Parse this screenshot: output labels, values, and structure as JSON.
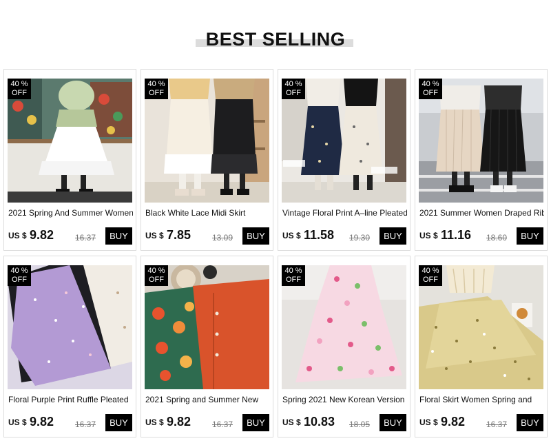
{
  "section": {
    "title": "BEST SELLING"
  },
  "products": [
    {
      "badge_pct": "40 %",
      "badge_off": "OFF",
      "title": "2021 Spring And Summer Women",
      "currency": "US $",
      "price": "9.82",
      "old_price": "16.37",
      "buy_label": "BUY"
    },
    {
      "badge_pct": "40 %",
      "badge_off": "OFF",
      "title": "Black White Lace Midi Skirt",
      "currency": "US $",
      "price": "7.85",
      "old_price": "13.09",
      "buy_label": "BUY"
    },
    {
      "badge_pct": "40 %",
      "badge_off": "OFF",
      "title": "Vintage Floral Print A–line Pleated",
      "currency": "US $",
      "price": "11.58",
      "old_price": "19.30",
      "buy_label": "BUY"
    },
    {
      "badge_pct": "40 %",
      "badge_off": "OFF",
      "title": "2021 Summer Women Draped Rib",
      "currency": "US $",
      "price": "11.16",
      "old_price": "18.60",
      "buy_label": "BUY"
    },
    {
      "badge_pct": "40 %",
      "badge_off": "OFF",
      "title": "Floral Purple Print Ruffle Pleated",
      "currency": "US $",
      "price": "9.82",
      "old_price": "16.37",
      "buy_label": "BUY"
    },
    {
      "badge_pct": "40 %",
      "badge_off": "OFF",
      "title": "2021 Spring and Summer New",
      "currency": "US $",
      "price": "9.82",
      "old_price": "16.37",
      "buy_label": "BUY"
    },
    {
      "badge_pct": "40 %",
      "badge_off": "OFF",
      "title": "Spring 2021 New Korean Version",
      "currency": "US $",
      "price": "10.83",
      "old_price": "18.05",
      "buy_label": "BUY"
    },
    {
      "badge_pct": "40 %",
      "badge_off": "OFF",
      "title": "Floral Skirt Women Spring and",
      "currency": "US $",
      "price": "9.82",
      "old_price": "16.37",
      "buy_label": "BUY"
    }
  ],
  "colors": {
    "badge_bg": "#000000",
    "buy_bg": "#000000",
    "old_price": "#777777",
    "card_border": "#dcdcdc"
  }
}
